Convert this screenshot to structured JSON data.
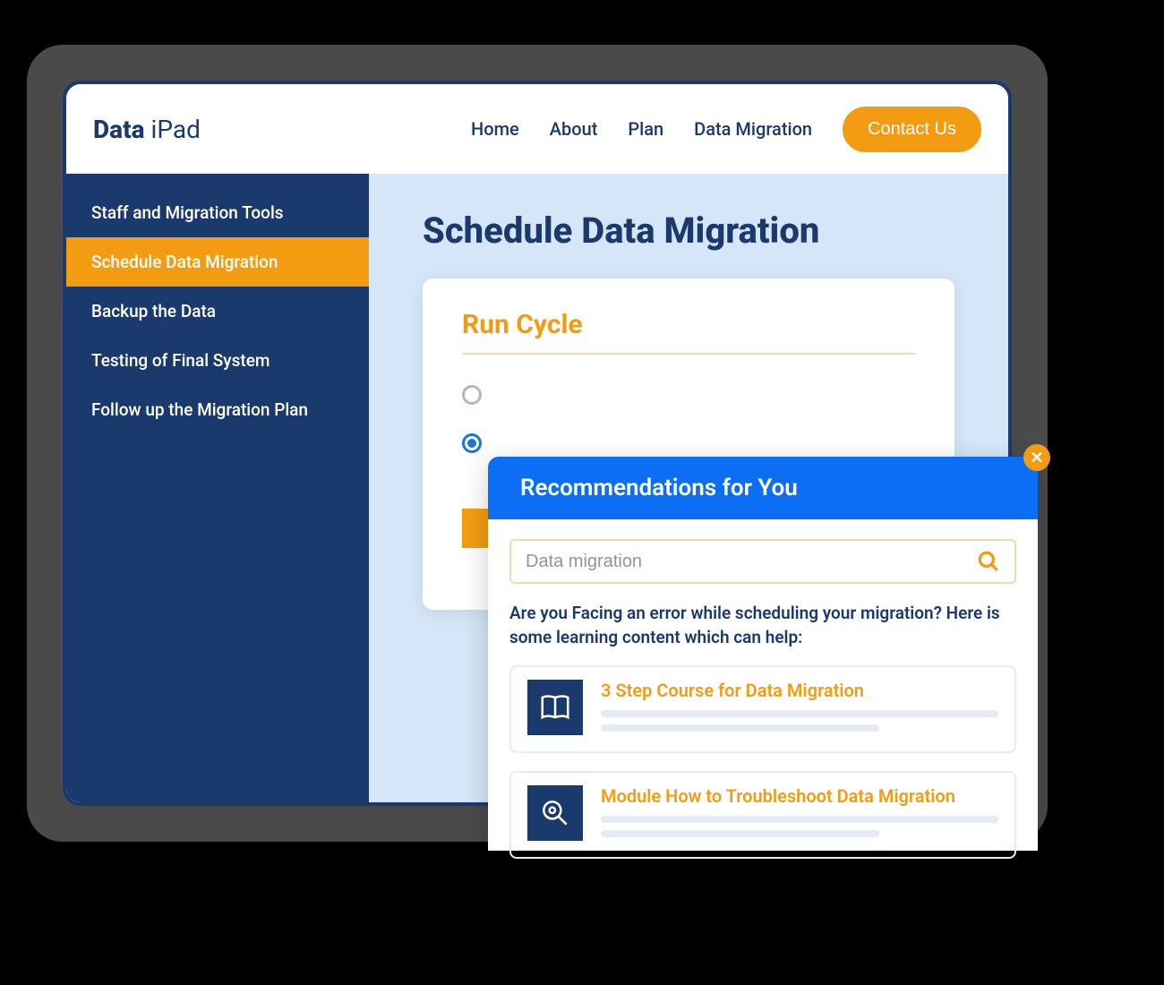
{
  "logo": {
    "bold": "Data",
    "light": " iPad"
  },
  "nav": {
    "items": [
      "Home",
      "About",
      "Plan",
      "Data Migration"
    ],
    "contact": "Contact Us"
  },
  "sidebar": {
    "items": [
      "Staff and Migration Tools",
      "Schedule Data Migration",
      "Backup the Data",
      "Testing of Final System",
      "Follow up the Migration Plan"
    ],
    "activeIndex": 1
  },
  "page": {
    "title": "Schedule Data Migration",
    "card_title": "Run Cycle"
  },
  "popup": {
    "title": "Recommendations for You",
    "search_value": "Data migration ",
    "prompt": "Are you Facing an error while scheduling your migration? Here is some learning content which can help:",
    "recs": [
      {
        "title": "3 Step Course for Data Migration",
        "icon": "book"
      },
      {
        "title": "Module How to Troubleshoot Data Migration",
        "icon": "search-gear"
      }
    ]
  }
}
